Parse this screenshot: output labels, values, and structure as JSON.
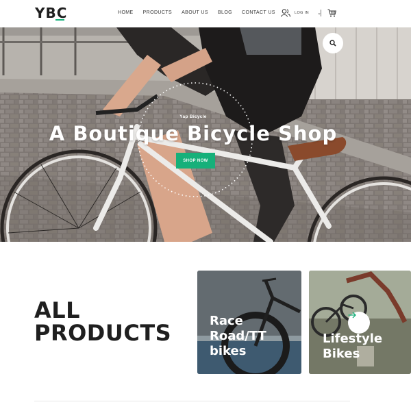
{
  "header": {
    "logo": "YBC",
    "nav": [
      "HOME",
      "PRODUCTS",
      "ABOUT US",
      "BLOG",
      "CONTACT US"
    ],
    "login_label": "LOG IN",
    "icons": [
      "user-icon",
      "chevron-down-icon",
      "cart-icon"
    ]
  },
  "hero": {
    "subtitle": "Yap Bicycle",
    "title": "A Boutique Bicycle Shop",
    "cta": "SHOP NOW",
    "search_icon": "search-icon"
  },
  "products": {
    "heading_line1": "ALL",
    "heading_line2": "PRODUCTS",
    "cards": [
      {
        "label_lines": [
          "Race",
          "Road/TT",
          "bikes"
        ]
      },
      {
        "label_lines": [
          "Lifestyle",
          "Bikes"
        ],
        "icon": "arrow-right-icon"
      }
    ]
  },
  "colors": {
    "accent": "#16b07a",
    "text_dark": "#1f1f1f"
  }
}
